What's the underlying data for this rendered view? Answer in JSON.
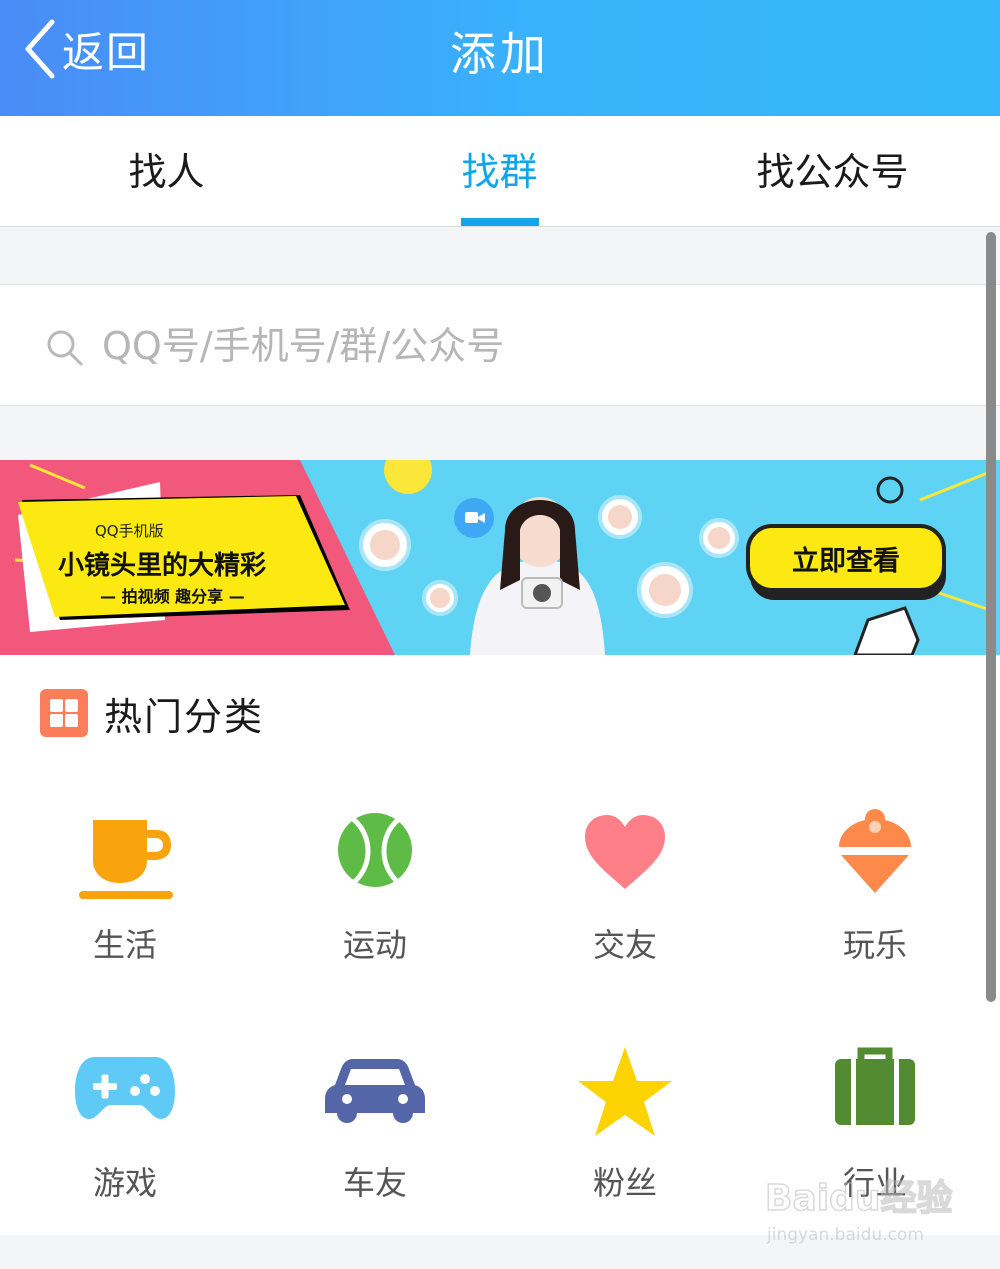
{
  "header": {
    "back_label": "返回",
    "title": "添加"
  },
  "tabs": [
    {
      "label": "找人",
      "active": false
    },
    {
      "label": "找群",
      "active": true
    },
    {
      "label": "找公众号",
      "active": false
    }
  ],
  "search": {
    "placeholder": "QQ号/手机号/群/公众号"
  },
  "banner": {
    "tag": "QQ手机版",
    "headline": "小镜头里的大精彩",
    "subline": "— 拍视频 趣分享 —",
    "cta": "立即查看"
  },
  "hot": {
    "title": "热门分类",
    "categories": [
      {
        "label": "生活",
        "icon": "coffee-cup-icon",
        "color": "#f9a30d"
      },
      {
        "label": "运动",
        "icon": "tennis-ball-icon",
        "color": "#5dbb46"
      },
      {
        "label": "交友",
        "icon": "heart-icon",
        "color": "#fe7f87"
      },
      {
        "label": "玩乐",
        "icon": "ice-cream-icon",
        "color": "#fd8a4a"
      },
      {
        "label": "游戏",
        "icon": "gamepad-icon",
        "color": "#5fcaf5"
      },
      {
        "label": "车友",
        "icon": "car-icon",
        "color": "#5466a8"
      },
      {
        "label": "粉丝",
        "icon": "star-icon",
        "color": "#fdd302"
      },
      {
        "label": "行业",
        "icon": "briefcase-icon",
        "color": "#538b32"
      }
    ]
  },
  "colors": {
    "accent": "#12a6e8",
    "header_start": "#4a8cf7",
    "header_end": "#35b8fb"
  },
  "watermark": {
    "text": "Baidu经验",
    "sub": "jingyan.baidu.com"
  }
}
